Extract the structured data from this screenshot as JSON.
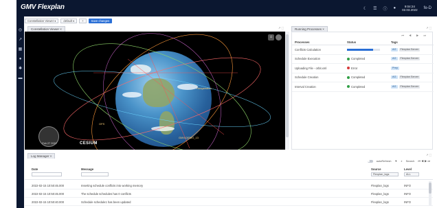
{
  "app": {
    "brand": "GMV Flexplan",
    "header_time": "9:04:24",
    "header_date": "02.03.2022",
    "header_user_label": "fe-D"
  },
  "toolbar": {
    "layout_select": "Constellation Viewer",
    "view_select": "default",
    "save_label": "Save changes"
  },
  "left_panel": {
    "tab_label": "Constellation Viewer",
    "globe_labels": [
      "Hoogstraten",
      "OFS",
      "GMV-DEMO_13"
    ],
    "cesium_label": "CESIUM",
    "clock_text": "Feb 27 2022"
  },
  "right_panel": {
    "tab_label": "Running Processes",
    "columns": [
      "Processes",
      "Status",
      "Tags"
    ],
    "rows": [
      {
        "process": "Conflicts Calculation",
        "status": "",
        "progress": 0.8,
        "tags": [
          "AG",
          "Flexplan Server"
        ]
      },
      {
        "process": "Schedule Execution",
        "status": "Completed",
        "state": "ok",
        "tags": [
          "AG",
          "Flexplan Server"
        ]
      },
      {
        "process": "Uploading File - orbit.xml",
        "status": "Error",
        "state": "err",
        "tags": [
          "Prep"
        ]
      },
      {
        "process": "Schedule Creation",
        "status": "Completed",
        "state": "ok",
        "tags": [
          "AG",
          "Flexplan Server"
        ]
      },
      {
        "process": "Interval Creation",
        "status": "Completed",
        "state": "ok",
        "tags": [
          "AG",
          "Flexplan Server"
        ]
      }
    ]
  },
  "log_manager": {
    "tab_label": "Log Manager",
    "autorefresh_label": "autoRefresh",
    "search_label": "Search",
    "columns": {
      "date": "Date",
      "message": "Message",
      "source": "Source",
      "level": "Level"
    },
    "filters": {
      "source": "Flexplan_logs",
      "level": "ALL"
    },
    "rows": [
      {
        "date": "2022-02-15 10:50:45.000",
        "message": "Inserting schedule conflicts into working memory",
        "source": "Flexplan_logs",
        "level": "INFO"
      },
      {
        "date": "2022-02-15 10:50:45.000",
        "message": "The schedule schedules has 0 conflicts",
        "source": "Flexplan_logs",
        "level": "INFO"
      },
      {
        "date": "2022-02-15 10:50:40.000",
        "message": "Schedule schedule1 has been updated",
        "source": "Flexplan_logs",
        "level": "INFO"
      }
    ]
  },
  "colors": {
    "topbar": "#0b1730",
    "accent": "#2a6fd6",
    "ok": "#2f9e44",
    "error": "#d63a3a"
  }
}
